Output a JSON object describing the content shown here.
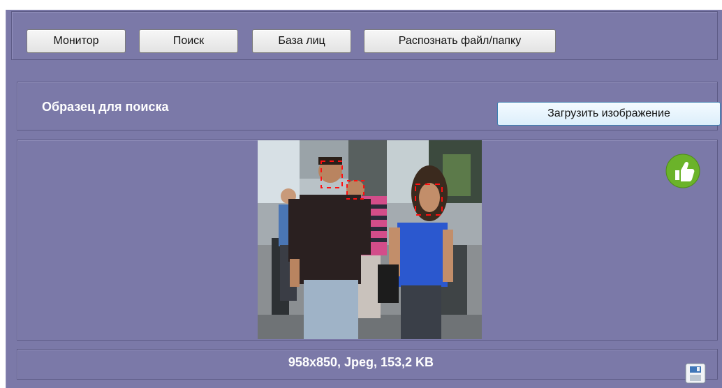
{
  "toolbar": {
    "buttons": [
      {
        "label": "Монитор"
      },
      {
        "label": "Поиск"
      },
      {
        "label": "База лиц"
      },
      {
        "label": "Распознать файл/папку"
      }
    ]
  },
  "sample": {
    "label": "Образец для поиска",
    "upload_button": "Загрузить изображение"
  },
  "image": {
    "status_icon": "thumbs-up-icon",
    "status_color": "#6bb32a"
  },
  "info": {
    "text": "958x850, Jpeg, 153,2 KB",
    "save_icon": "save-icon"
  }
}
